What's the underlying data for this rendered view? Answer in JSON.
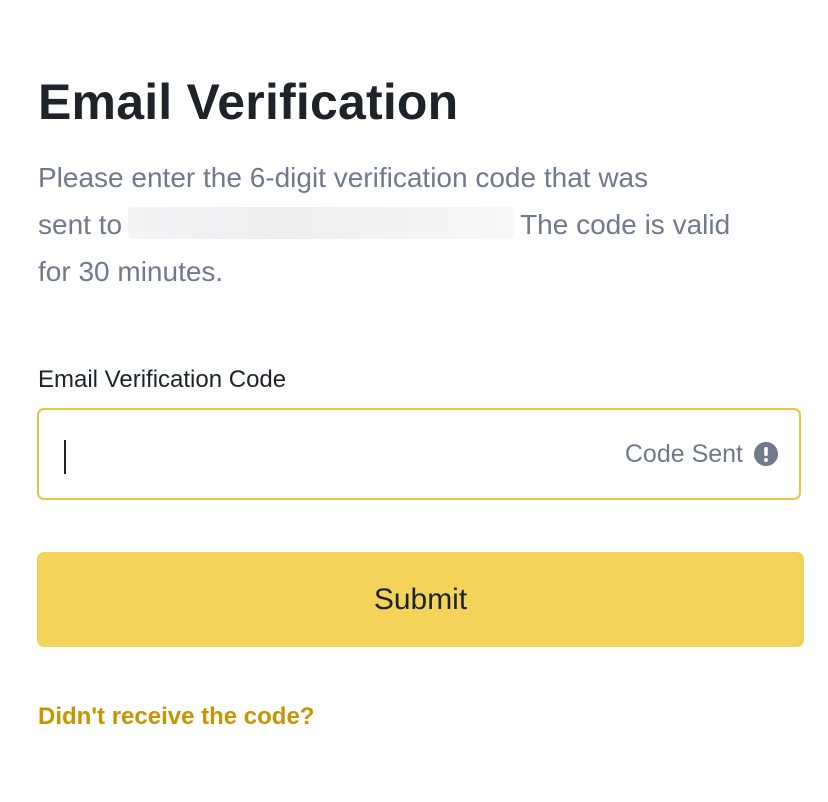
{
  "header": {
    "title": "Email Verification"
  },
  "description": {
    "line1": "Please enter the 6-digit verification code that was",
    "line2_prefix": "sent to",
    "line2_suffix": "The code is valid",
    "line3": "for 30 minutes."
  },
  "form": {
    "field_label": "Email Verification Code",
    "input_value": "",
    "input_placeholder": "",
    "code_sent_label": "Code Sent",
    "code_sent_icon": "info-icon",
    "submit_label": "Submit"
  },
  "footer": {
    "help_link": "Didn't receive the code?"
  },
  "colors": {
    "accent": "#f4d35a",
    "input_border": "#e8c53f",
    "link": "#c99400",
    "title_text": "#1e2329",
    "muted_text": "#707a8a"
  }
}
